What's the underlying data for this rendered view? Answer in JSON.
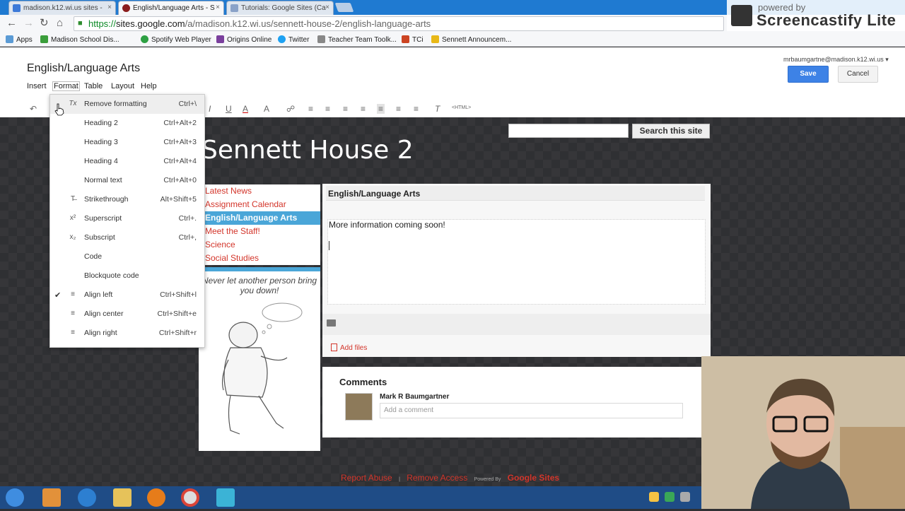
{
  "browser": {
    "tabs": [
      {
        "title": "madison.k12.wi.us sites - ",
        "active": false,
        "color": "#3d7ad8"
      },
      {
        "title": "English/Language Arts - S",
        "active": true,
        "color": "#8a1c1c"
      },
      {
        "title": "Tutorials: Google Sites (Ca",
        "active": false,
        "color": "#8aa2c8"
      }
    ],
    "close_glyph": "×",
    "url_scheme": "https://",
    "url_host": "sites.google.com",
    "url_path": "/a/madison.k12.wi.us/sennett-house-2/english-language-arts",
    "bookmarks": [
      "Apps",
      "Madison School Dis...",
      "Spotify Web Player",
      "Origins Online",
      "Twitter",
      "Teacher Team Toolk...",
      "TCi",
      "Sennett Announcem..."
    ],
    "bookmark_colors": [
      "#5b9bd5",
      "#3b9e3b",
      "#2ea043",
      "#7a3f9d",
      "#1da1f2",
      "#888",
      "#c42",
      "#e8b817"
    ]
  },
  "screencastify": {
    "powered": "powered by",
    "name": "Screencastify Lite"
  },
  "editor": {
    "title": "English/Language Arts",
    "user_email": "mrbaumgartne@madison.k12.wi.us",
    "save": "Save",
    "cancel": "Cancel",
    "menus": [
      "Insert",
      "Format",
      "Table",
      "Layout",
      "Help"
    ],
    "html_label": "<HTML>"
  },
  "format_menu": [
    {
      "icon": "Tx",
      "label": "Remove formatting",
      "shortcut": "Ctrl+\\",
      "checked": false
    },
    {
      "icon": "",
      "label": "Heading 2",
      "shortcut": "Ctrl+Alt+2",
      "checked": false
    },
    {
      "icon": "",
      "label": "Heading 3",
      "shortcut": "Ctrl+Alt+3",
      "checked": false
    },
    {
      "icon": "",
      "label": "Heading 4",
      "shortcut": "Ctrl+Alt+4",
      "checked": false
    },
    {
      "icon": "",
      "label": "Normal text",
      "shortcut": "Ctrl+Alt+0",
      "checked": false
    },
    {
      "icon": "T̶",
      "label": "Strikethrough",
      "shortcut": "Alt+Shift+5",
      "checked": false
    },
    {
      "icon": "x²",
      "label": "Superscript",
      "shortcut": "Ctrl+.",
      "checked": false
    },
    {
      "icon": "x₂",
      "label": "Subscript",
      "shortcut": "Ctrl+,",
      "checked": false
    },
    {
      "icon": "",
      "label": "Code",
      "shortcut": "",
      "checked": false
    },
    {
      "icon": "",
      "label": "Blockquote code",
      "shortcut": "",
      "checked": false
    },
    {
      "icon": "≡",
      "label": "Align left",
      "shortcut": "Ctrl+Shift+l",
      "checked": true
    },
    {
      "icon": "≡",
      "label": "Align center",
      "shortcut": "Ctrl+Shift+e",
      "checked": false
    },
    {
      "icon": "≡",
      "label": "Align right",
      "shortcut": "Ctrl+Shift+r",
      "checked": false
    }
  ],
  "check_glyph": "✔",
  "site": {
    "search_button": "Search this site",
    "title": "Sennett House 2",
    "nav": [
      "Latest News",
      "Assignment Calendar",
      "English/Language Arts",
      "Meet the Staff!",
      "Science",
      "Social Studies"
    ],
    "nav_selected": 2,
    "quote": "Never let another person bring you down!",
    "page_heading": "English/Language Arts",
    "content": "More information coming soon!",
    "add_files": "Add files",
    "comments_title": "Comments",
    "comment_author": "Mark R Baumgartner",
    "comment_placeholder": "Add a comment",
    "footer": {
      "report": "Report Abuse",
      "remove": "Remove Access",
      "powered": "Powered By",
      "sites": "Google Sites"
    }
  },
  "colors": {
    "accent": "#3d82e6",
    "link": "#d3352a",
    "nav_selected": "#4aa6d8"
  }
}
